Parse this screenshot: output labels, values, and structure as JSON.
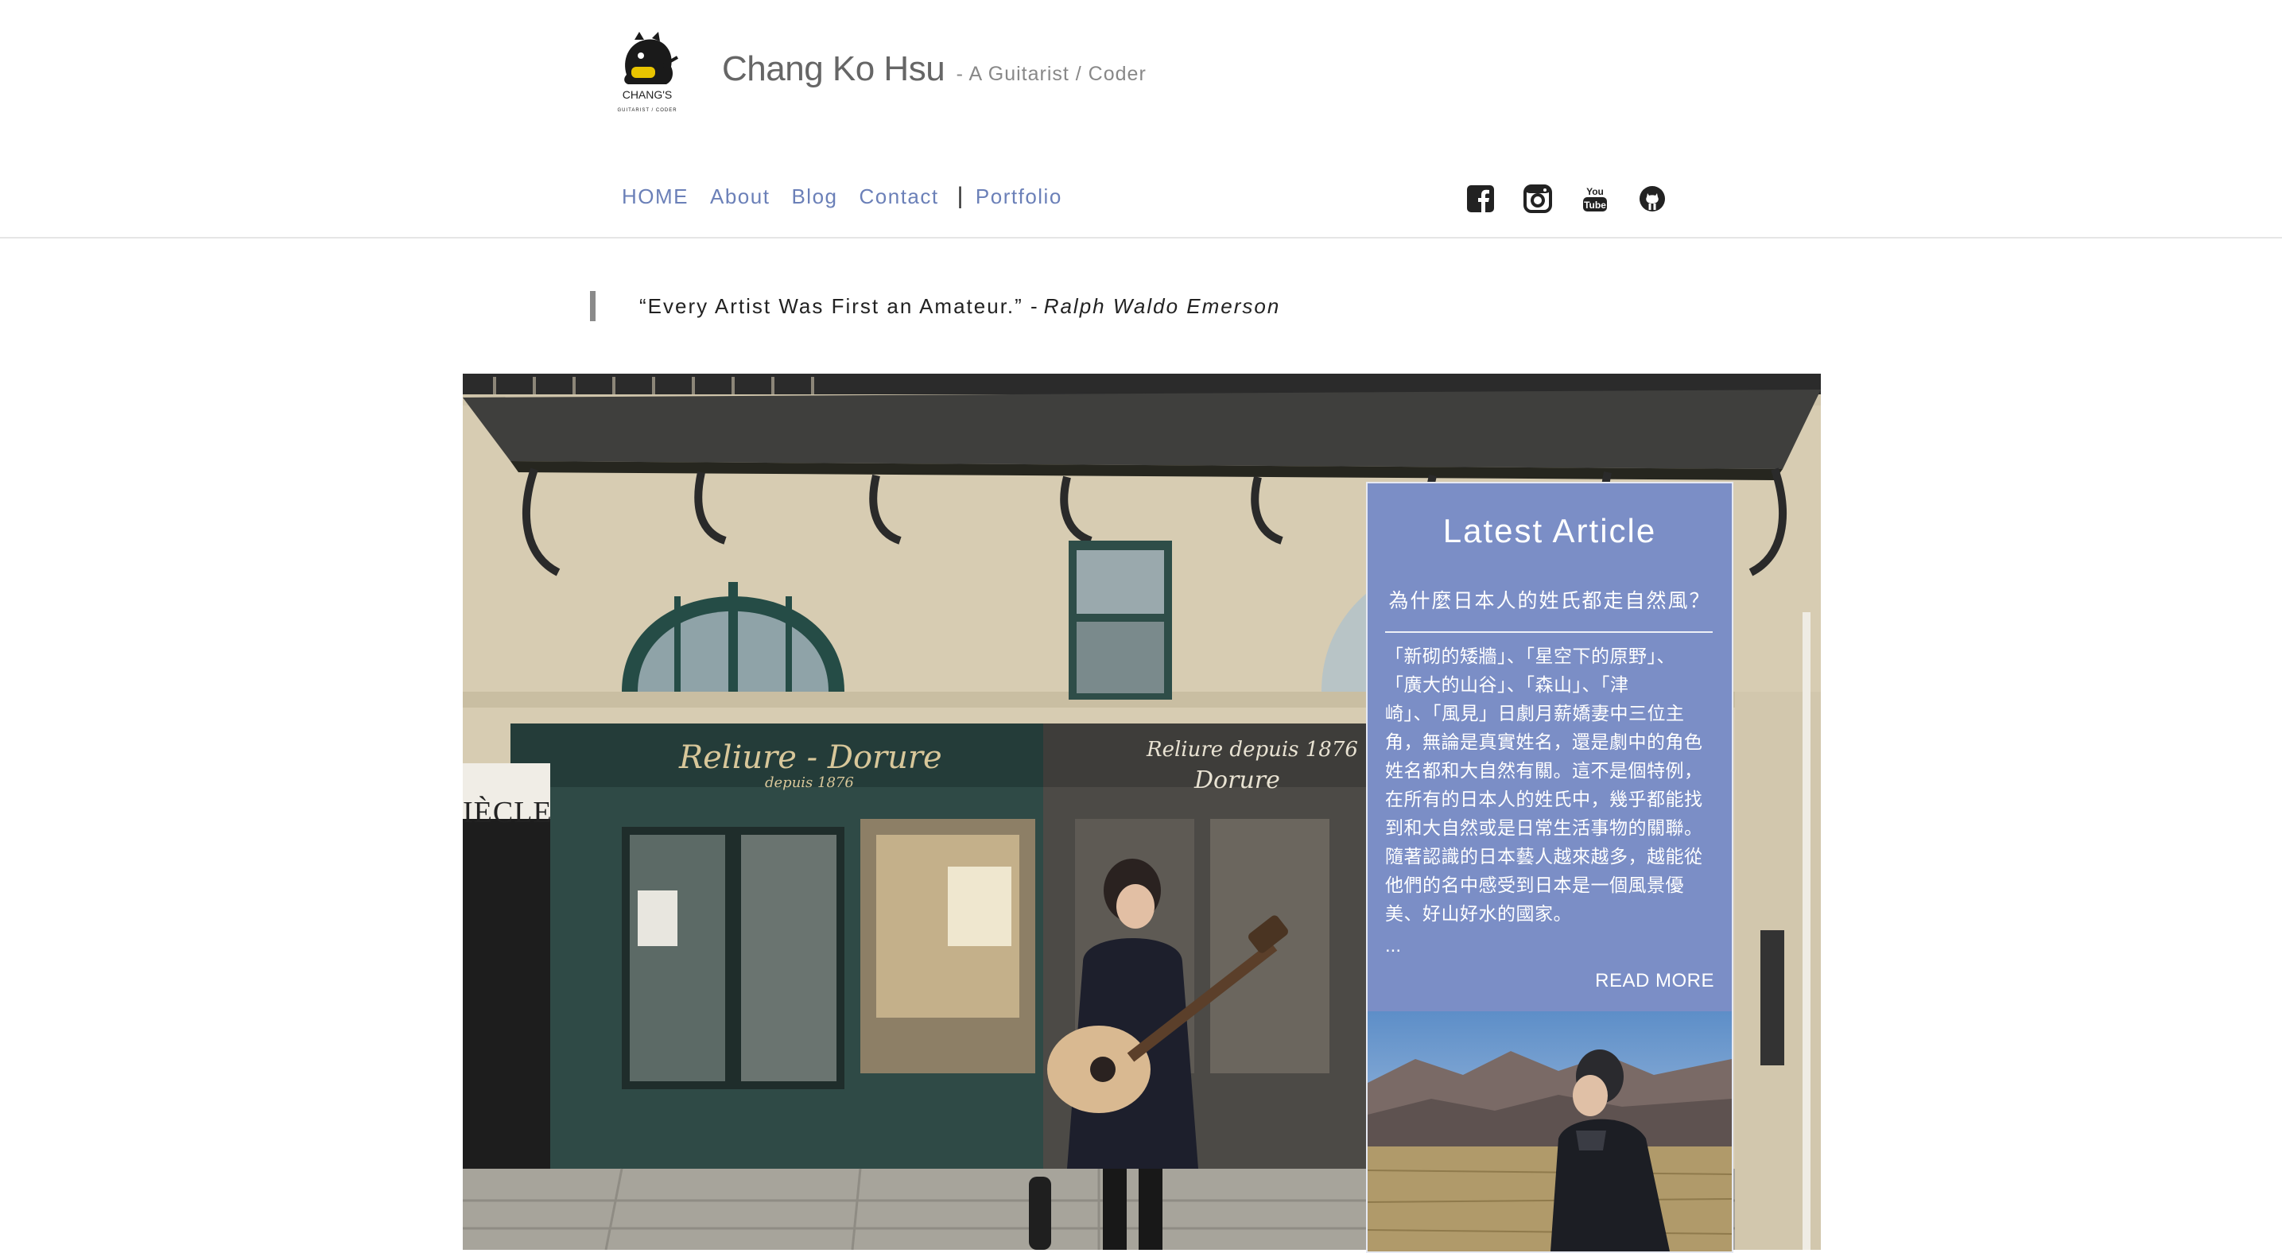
{
  "site": {
    "logo_text": "CHANG'S",
    "logo_subtext": "GUITARIST / CODER",
    "name": "Chang Ko Hsu",
    "tagline": "- A Guitarist / Coder"
  },
  "nav": {
    "items": [
      {
        "label": "HOME"
      },
      {
        "label": "About"
      },
      {
        "label": "Blog"
      },
      {
        "label": "Contact"
      }
    ],
    "separator": "|",
    "portfolio": "Portfolio"
  },
  "social": [
    "facebook-icon",
    "instagram-icon",
    "youtube-icon",
    "github-icon"
  ],
  "quote": {
    "text": "“Every Artist Was First an Amateur.” -",
    "author": "Ralph Waldo Emerson"
  },
  "hero": {
    "sign_left": "Reliure - Dorure",
    "sign_left_sub": "depuis 1876",
    "sign_right": "Reliure depuis 1876",
    "sign_right_sub": "Dorure",
    "side_sign": "IÈCLE"
  },
  "article": {
    "heading": "Latest Article",
    "title": "為什麼日本人的姓氏都走自然風？",
    "excerpt_lines": [
      "「新砌的矮牆」、「星空下的原野」、",
      "「廣大的山谷」、「森山」、「津",
      "崎」、「風見」日劇月薪嬌妻中三位主",
      "角，無論是真實姓名，還是劇中的角色",
      "姓名都和大自然有關。這不是個特例，",
      "在所有的日本人的姓氏中，幾乎都能找",
      "到和大自然或是日常生活事物的關聯。",
      "隨著認識的日本藝人越來越多，越能從",
      "他們的名中感受到日本是一個風景優",
      "美、好山好水的國家。"
    ],
    "ellipsis": "...",
    "read_more": "READ MORE"
  },
  "colors": {
    "nav_link": "#6b80b8",
    "card_bg": "#7b8ec6",
    "quote_bar": "#8a8a8a"
  }
}
